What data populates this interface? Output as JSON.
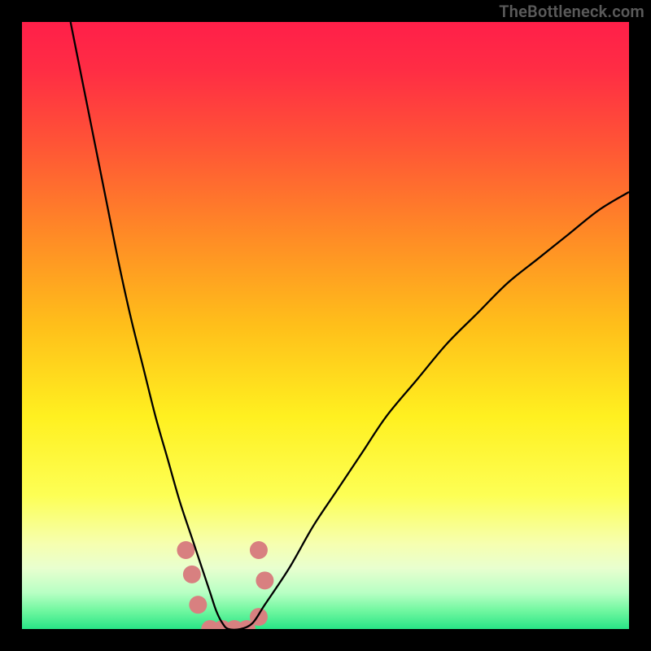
{
  "watermark": "TheBottleneck.com",
  "chart_data": {
    "type": "line",
    "title": "",
    "xlabel": "",
    "ylabel": "",
    "xlim": [
      0,
      100
    ],
    "ylim": [
      0,
      100
    ],
    "background_gradient": {
      "stops": [
        {
          "offset": 0.0,
          "color": "#ff1f49"
        },
        {
          "offset": 0.08,
          "color": "#ff2d44"
        },
        {
          "offset": 0.2,
          "color": "#ff5436"
        },
        {
          "offset": 0.35,
          "color": "#ff8a26"
        },
        {
          "offset": 0.5,
          "color": "#ffbf1a"
        },
        {
          "offset": 0.65,
          "color": "#fff020"
        },
        {
          "offset": 0.78,
          "color": "#fdff55"
        },
        {
          "offset": 0.86,
          "color": "#f6ffb0"
        },
        {
          "offset": 0.9,
          "color": "#e8ffcf"
        },
        {
          "offset": 0.94,
          "color": "#b8ffc4"
        },
        {
          "offset": 0.97,
          "color": "#70f7a0"
        },
        {
          "offset": 1.0,
          "color": "#28e586"
        }
      ]
    },
    "series": [
      {
        "name": "bottleneck-curve",
        "color": "#000000",
        "x": [
          8,
          10,
          12,
          14,
          16,
          18,
          20,
          22,
          24,
          26,
          28,
          30,
          31,
          32,
          33,
          34,
          36,
          38,
          40,
          44,
          48,
          52,
          56,
          60,
          65,
          70,
          75,
          80,
          85,
          90,
          95,
          100
        ],
        "values": [
          100,
          90,
          80,
          70,
          60,
          51,
          43,
          35,
          28,
          21,
          15,
          9,
          6,
          3,
          1,
          0,
          0,
          1,
          4,
          10,
          17,
          23,
          29,
          35,
          41,
          47,
          52,
          57,
          61,
          65,
          69,
          72
        ]
      }
    ],
    "markers": {
      "name": "highlight-cluster",
      "color": "#d88080",
      "points": [
        {
          "x": 27,
          "y": 13
        },
        {
          "x": 28,
          "y": 9
        },
        {
          "x": 29,
          "y": 4
        },
        {
          "x": 31,
          "y": 0
        },
        {
          "x": 33,
          "y": 0
        },
        {
          "x": 35,
          "y": 0
        },
        {
          "x": 37,
          "y": 0
        },
        {
          "x": 39,
          "y": 2
        },
        {
          "x": 40,
          "y": 8
        },
        {
          "x": 39,
          "y": 13
        }
      ]
    }
  }
}
